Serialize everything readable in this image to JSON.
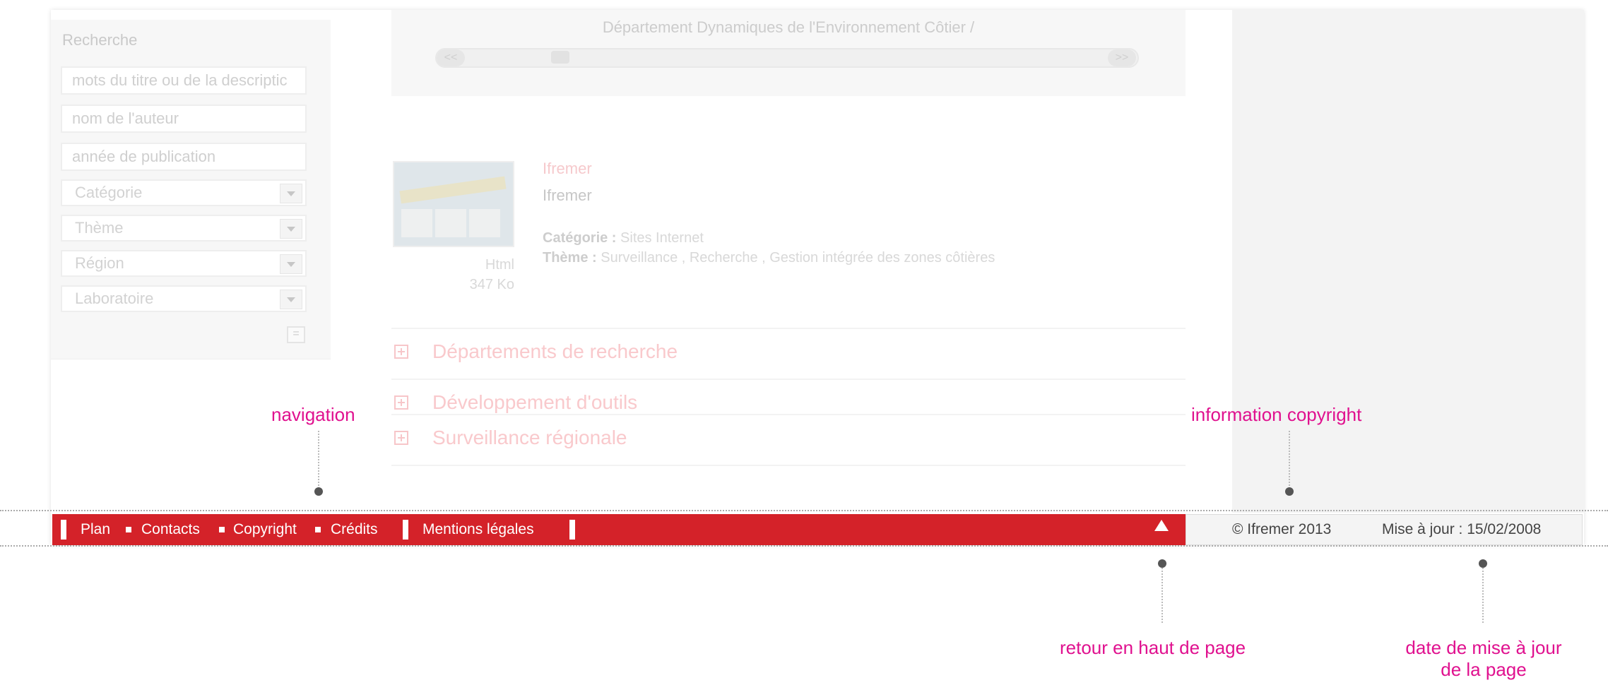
{
  "sidebar": {
    "title": "Recherche",
    "title_input_placeholder": "mots du titre ou de la descriptic",
    "author_input_placeholder": "nom de l'auteur",
    "year_input_placeholder": "année de publication",
    "selects": [
      "Catégorie",
      "Thème",
      "Région",
      "Laboratoire"
    ],
    "submit_label": "="
  },
  "scroller": {
    "title": "Département Dynamiques de l'Environnement Côtier /",
    "prev_label": "<<",
    "next_label": ">>"
  },
  "document": {
    "link_title": "Ifremer",
    "name": "Ifremer",
    "format": "Html",
    "size": "347 Ko",
    "category_label": "Catégorie :",
    "category_value": "Sites Internet",
    "theme_label": "Thème :",
    "theme_value": "Surveillance ,  Recherche ,  Gestion intégrée des zones côtières"
  },
  "accordion": [
    "Départements de recherche",
    "Développement d'outils",
    "Surveillance régionale"
  ],
  "footer": {
    "links": [
      "Plan",
      "Contacts",
      "Copyright",
      "Crédits",
      "Mentions légales"
    ],
    "copyright": "© Ifremer 2013",
    "updated": "Mise à jour : 15/02/2008"
  },
  "annotations": {
    "navigation": "navigation",
    "copyright_info": "information copyright",
    "back_to_top": "retour en haut de page",
    "update_date_line1": "date de mise à jour",
    "update_date_line2": "de la page"
  },
  "colors": {
    "footer_red": "#d42229",
    "annotation_pink": "#e0118f"
  }
}
